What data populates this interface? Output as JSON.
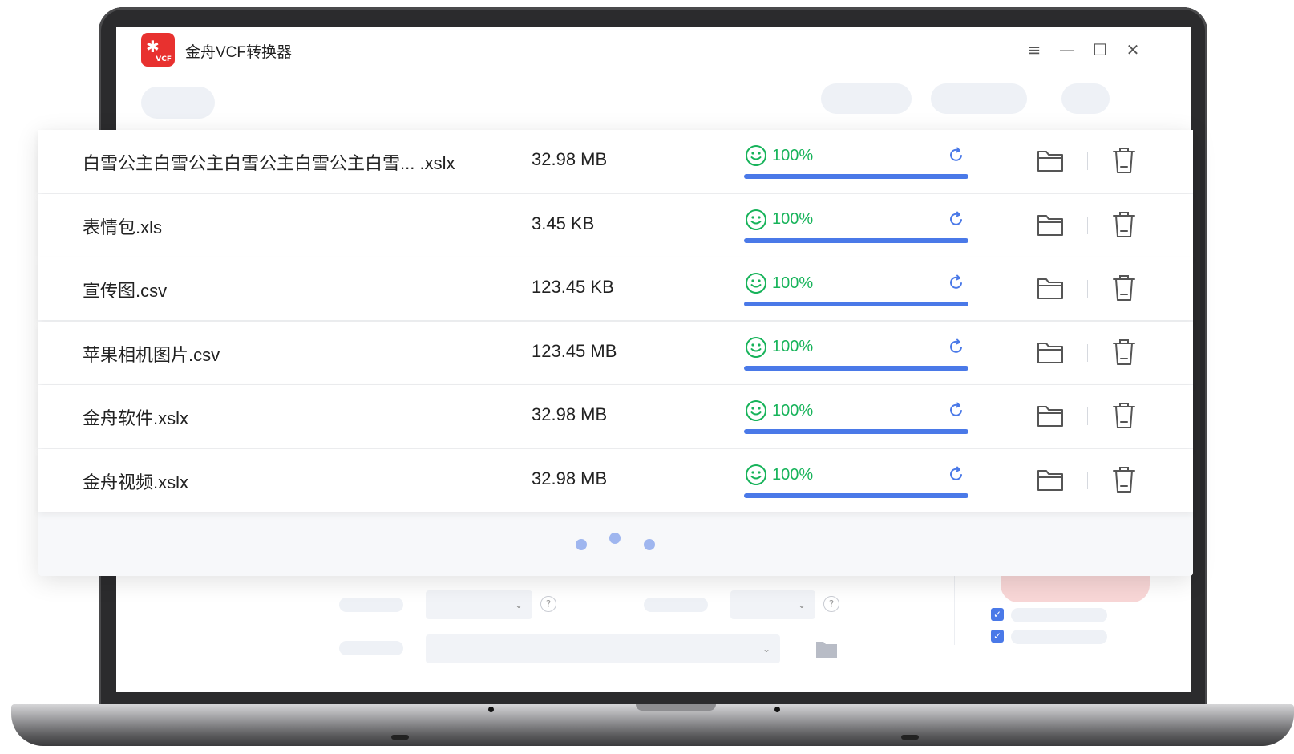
{
  "app": {
    "title": "金舟VCF转换器",
    "logo_text": "VCF"
  },
  "window_controls": {
    "menu_icon": "≡",
    "minimize_icon": "—",
    "maximize_icon": "☐",
    "close_icon": "✕"
  },
  "files": [
    {
      "name": "白雪公主白雪公主白雪公主白雪公主白雪... .xslx",
      "size": "32.98 MB",
      "status": "100%",
      "progress": 100
    },
    {
      "name": "表情包.xls",
      "size": "3.45 KB",
      "status": "100%",
      "progress": 100
    },
    {
      "name": "宣传图.csv",
      "size": "123.45 KB",
      "status": "100%",
      "progress": 100
    },
    {
      "name": "苹果相机图片.csv",
      "size": "123.45 MB",
      "status": "100%",
      "progress": 100
    },
    {
      "name": "金舟软件.xslx",
      "size": "32.98 MB",
      "status": "100%",
      "progress": 100
    },
    {
      "name": "金舟视频.xslx",
      "size": "32.98 MB",
      "status": "100%",
      "progress": 100
    }
  ],
  "background": {
    "help_mark": "?",
    "dropdown_icon": "⌄",
    "check_mark": "✓"
  },
  "colors": {
    "accent": "#4a79e8",
    "success": "#17b35a",
    "brand": "#e8312f"
  },
  "icons": [
    "smile-icon",
    "retry-icon",
    "folder-icon",
    "trash-icon",
    "chevron-down-icon",
    "help-icon"
  ]
}
